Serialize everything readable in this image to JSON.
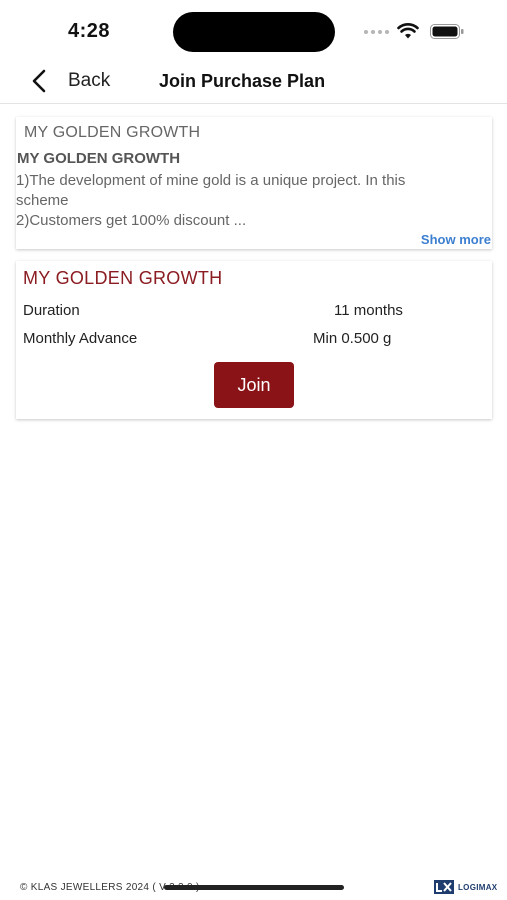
{
  "status_bar": {
    "time": "4:28"
  },
  "nav": {
    "back_label": "Back",
    "title": "Join Purchase Plan"
  },
  "description_card": {
    "heading": "MY GOLDEN GROWTH",
    "subheading": "MY GOLDEN GROWTH",
    "lines": [
      "1)The development of mine gold is a unique project. In this",
      "scheme",
      "2)Customers get 100% discount ..."
    ],
    "show_more_label": "Show more"
  },
  "plan_card": {
    "name": "MY GOLDEN GROWTH",
    "duration_label": "Duration",
    "duration_value": "11 months",
    "advance_label": "Monthly Advance",
    "advance_value": "Min 0.500 g",
    "join_label": "Join"
  },
  "footer": {
    "copyright": "© KLAS JEWELLERS 2024 ( V-3.2.0 )",
    "logo_text": "LOGIMAX"
  },
  "colors": {
    "accent": "#8a1318",
    "link": "#3c7fd0",
    "plan_name": "#8a1c22"
  }
}
